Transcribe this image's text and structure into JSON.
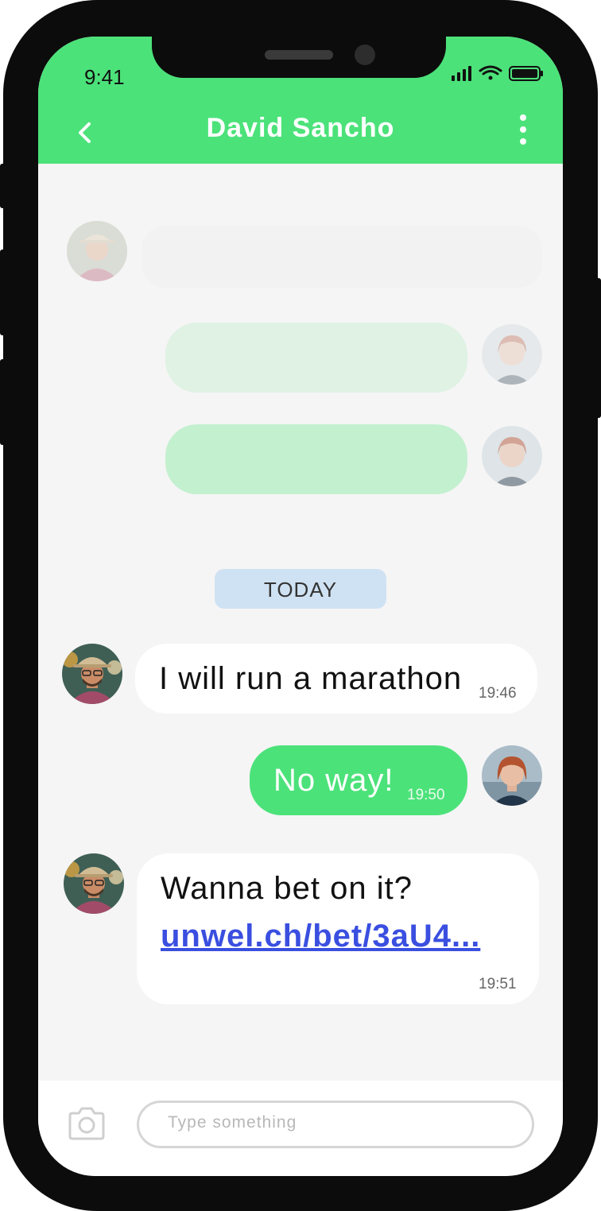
{
  "status_bar": {
    "time": "9:41"
  },
  "header": {
    "title": "David Sancho",
    "back_icon": "chevron-left-icon",
    "menu_icon": "more-vertical-icon"
  },
  "colors": {
    "accent": "#4ce27a",
    "link": "#3a4fe0",
    "date_chip": "#cfe2f3"
  },
  "date_divider": "TODAY",
  "messages": [
    {
      "sender": "David Sancho",
      "direction": "incoming",
      "text": "I will run a marathon",
      "time": "19:46"
    },
    {
      "sender": "me",
      "direction": "outgoing",
      "text": "No way!",
      "time": "19:50"
    },
    {
      "sender": "David Sancho",
      "direction": "incoming",
      "text": "Wanna bet on it?",
      "link": "unwel.ch/bet/3aU4...",
      "time": "19:51"
    }
  ],
  "composer": {
    "placeholder": "Type something",
    "camera_icon": "camera-icon"
  }
}
